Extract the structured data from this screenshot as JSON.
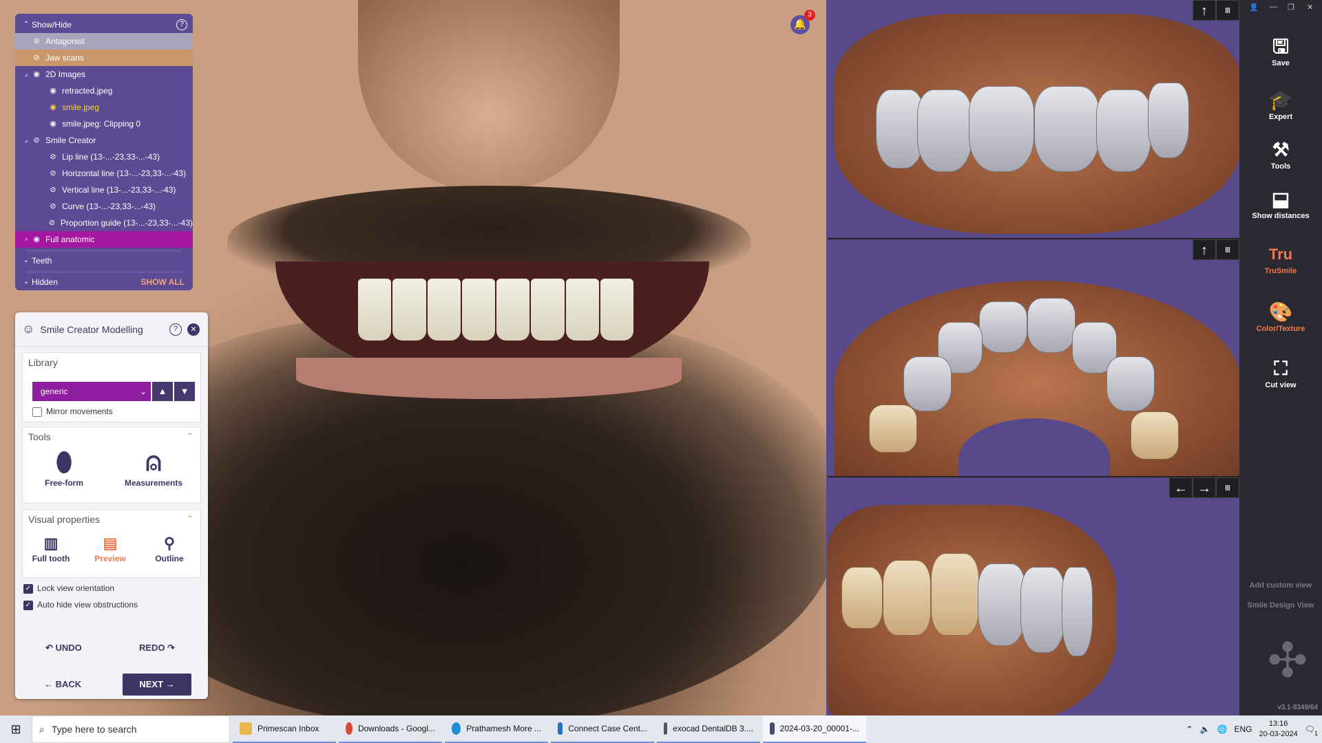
{
  "show_hide": {
    "title": "Show/Hide",
    "help": "?",
    "items": [
      {
        "label": "Antagonist"
      },
      {
        "label": "Jaw scans"
      },
      {
        "label": "2D Images"
      },
      {
        "label": "retracted.jpeg"
      },
      {
        "label": "smile.jpeg"
      },
      {
        "label": "smile.jpeg: Clipping 0"
      },
      {
        "label": "Smile Creator"
      },
      {
        "label": "Lip line (13-...-23,33-...-43)"
      },
      {
        "label": "Horizontal line (13-...-23,33-...-43)"
      },
      {
        "label": "Vertical line (13-...-23,33-...-43)"
      },
      {
        "label": "Curve (13-...-23,33-...-43)"
      },
      {
        "label": "Proportion guide (13-...-23,33-...-43)"
      },
      {
        "label": "Full anatomic"
      },
      {
        "label": "Teeth"
      },
      {
        "label": "Hidden"
      }
    ],
    "show_all": "SHOW ALL"
  },
  "notification_count": "3",
  "scm": {
    "title": "Smile Creator Modelling",
    "help": "?",
    "library_label": "Library",
    "library_value": "generic",
    "mirror_label": "Mirror movements",
    "tools_label": "Tools",
    "tools": [
      "Free-form",
      "Measurements"
    ],
    "visual_label": "Visual properties",
    "visual": [
      "Full tooth",
      "Preview",
      "Outline"
    ],
    "lock_label": "Lock view orientation",
    "autohide_label": "Auto hide view obstructions",
    "undo": "UNDO",
    "redo": "REDO",
    "back": "BACK",
    "next": "NEXT"
  },
  "right_bar": {
    "items": [
      "Save",
      "Expert",
      "Tools",
      "Show distances",
      "TruSmile",
      "Color/Texture",
      "Cut view"
    ],
    "tru_logo": "Tru",
    "add_custom_view": "Add custom view",
    "smile_design_view": "Smile Design View",
    "version": "v3.1-8349/64"
  },
  "taskbar": {
    "search_placeholder": "Type here to search",
    "tasks": [
      "Primescan Inbox",
      "Downloads - Googl...",
      "Prathamesh More ...",
      "Connect Case Cent...",
      "exocad DentalDB 3....",
      "2024-03-20_00001-..."
    ],
    "lang": "ENG",
    "time": "13:16",
    "date": "20-03-2024",
    "notif": "1"
  },
  "colors": {
    "panel_purple": "#5b4a94",
    "accent_magenta": "#8e1e9f",
    "navy": "#3d3563",
    "orange": "#f27a4a"
  }
}
